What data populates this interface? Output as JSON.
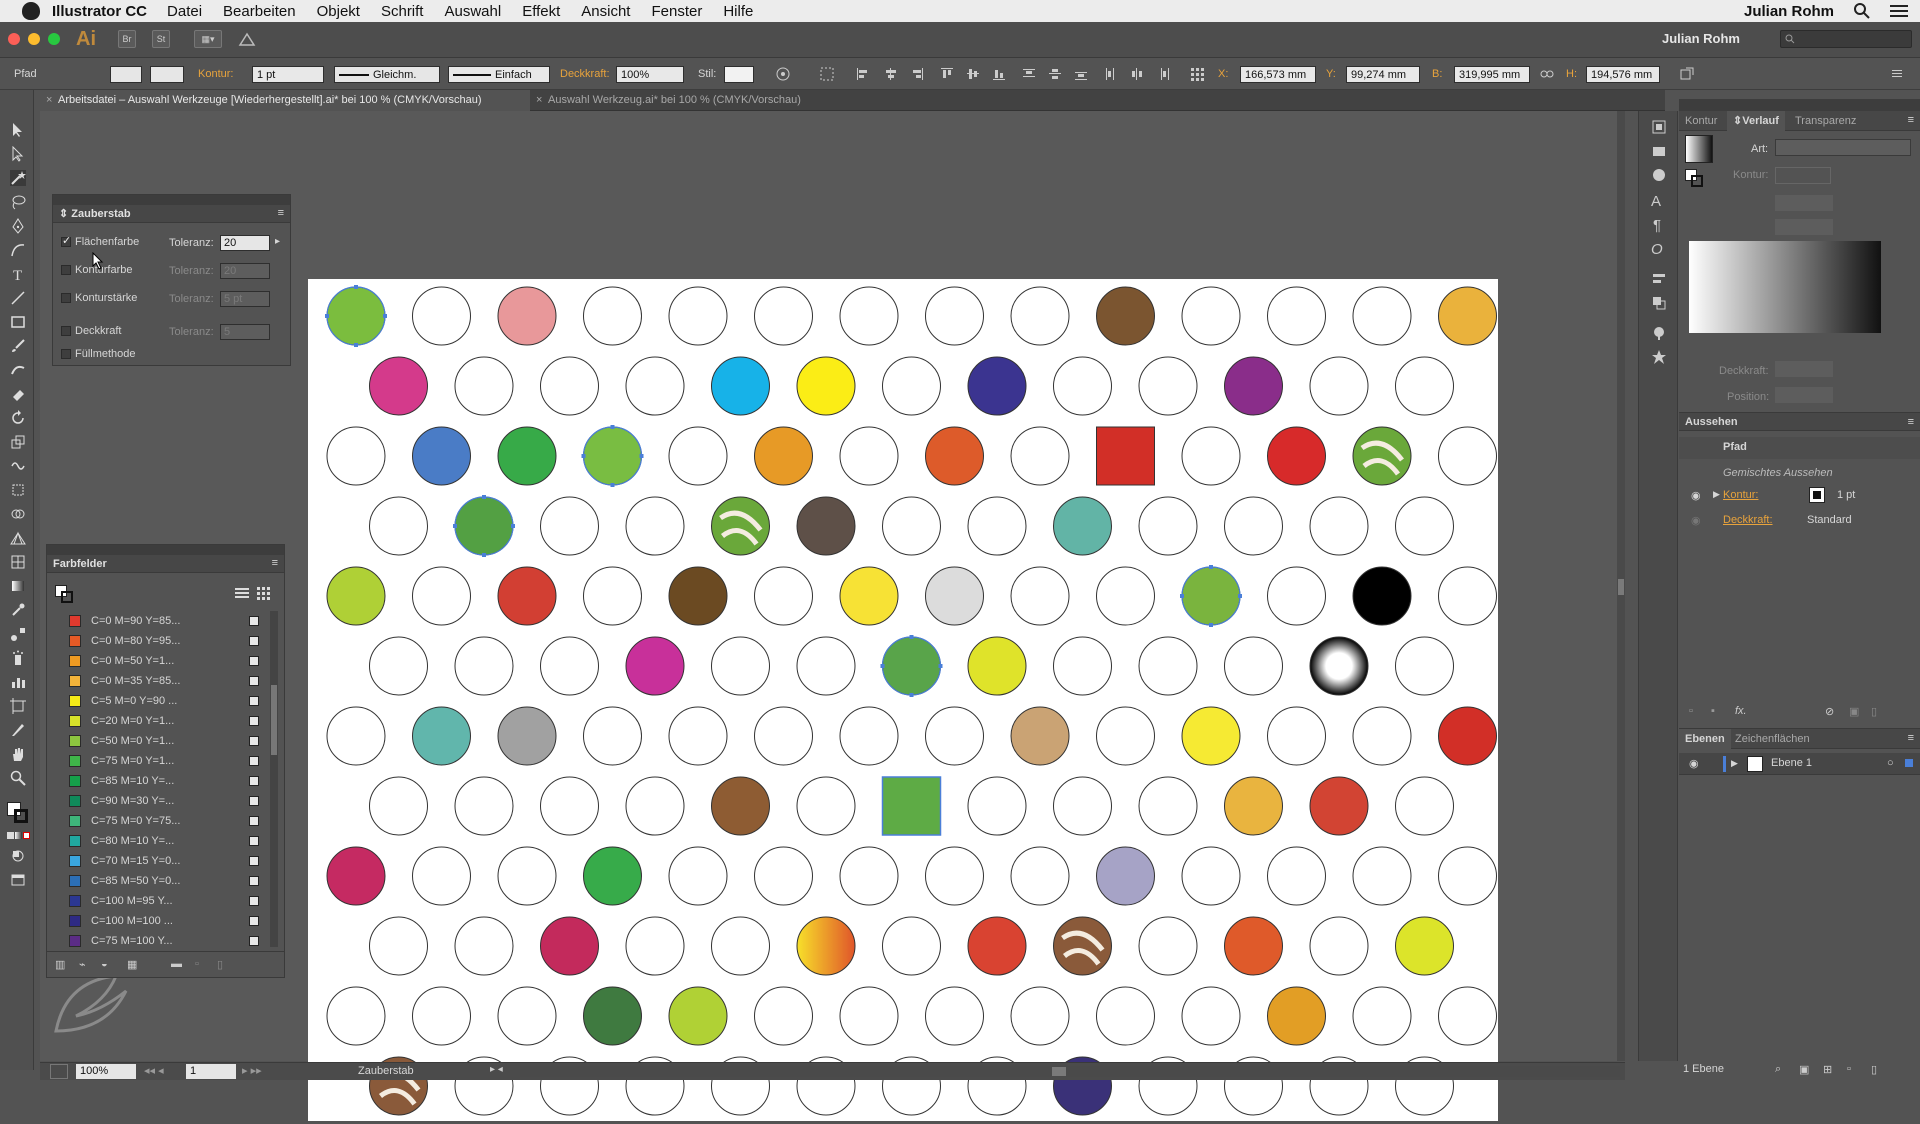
{
  "menubar": {
    "app_name": "Illustrator CC",
    "items": [
      "Datei",
      "Bearbeiten",
      "Objekt",
      "Schrift",
      "Auswahl",
      "Effekt",
      "Ansicht",
      "Fenster",
      "Hilfe"
    ],
    "user": "Julian Rohm"
  },
  "appbar": {
    "logo": "Ai",
    "bridge": "Br",
    "stock": "St",
    "workspace": "Julian Rohm"
  },
  "control": {
    "selection": "Pfad",
    "kontur_label": "Kontur:",
    "kontur_value": "1 pt",
    "stroke_profile": "Gleichm.",
    "brush": "Einfach",
    "deckkraft_label": "Deckkraft:",
    "deckkraft_value": "100%",
    "stil_label": "Stil:",
    "x_label": "X:",
    "x_value": "166,573 mm",
    "y_label": "Y:",
    "y_value": "99,274 mm",
    "b_label": "B:",
    "b_value": "319,995 mm",
    "h_label": "H:",
    "h_value": "194,576 mm"
  },
  "tabs": [
    {
      "label": "Arbeitsdatei – Auswahl Werkzeuge [Wiederhergestellt].ai* bei 100 % (CMYK/Vorschau)",
      "active": true
    },
    {
      "label": "Auswahl Werkzeug.ai* bei 100 % (CMYK/Vorschau)",
      "active": false
    }
  ],
  "zauberstab": {
    "title": "Zauberstab",
    "options": [
      {
        "label": "Flächenfarbe",
        "checked": true,
        "tol_label": "Toleranz:",
        "tol": "20",
        "enabled": true
      },
      {
        "label": "Konturfarbe",
        "checked": false,
        "tol_label": "Toleranz:",
        "tol": "20",
        "enabled": false
      },
      {
        "label": "Konturstärke",
        "checked": false,
        "tol_label": "Toleranz:",
        "tol": "5 pt",
        "enabled": false
      },
      {
        "label": "Deckkraft",
        "checked": false,
        "tol_label": "Toleranz:",
        "tol": "5",
        "enabled": false
      },
      {
        "label": "Füllmethode",
        "checked": false,
        "tol_label": "",
        "tol": "",
        "enabled": false
      }
    ]
  },
  "farbfelder": {
    "title": "Farbfelder",
    "swatches": [
      {
        "label": "C=0 M=90 Y=85...",
        "color": "#e03a2e"
      },
      {
        "label": "C=0 M=80 Y=95...",
        "color": "#e55a26"
      },
      {
        "label": "C=0 M=50 Y=1...",
        "color": "#ee9a22"
      },
      {
        "label": "C=0 M=35 Y=85...",
        "color": "#f4b43a"
      },
      {
        "label": "C=5 M=0 Y=90 ...",
        "color": "#f5ea17"
      },
      {
        "label": "C=20 M=0 Y=1...",
        "color": "#d7e22a"
      },
      {
        "label": "C=50 M=0 Y=1...",
        "color": "#8dc63f"
      },
      {
        "label": "C=75 M=0 Y=1...",
        "color": "#3fb549"
      },
      {
        "label": "C=85 M=10 Y=...",
        "color": "#15a04a"
      },
      {
        "label": "C=90 M=30 Y=...",
        "color": "#108a5a"
      },
      {
        "label": "C=75 M=0 Y=75...",
        "color": "#3eb57a"
      },
      {
        "label": "C=80 M=10 Y=...",
        "color": "#20a8a0"
      },
      {
        "label": "C=70 M=15 Y=0...",
        "color": "#3aa6df"
      },
      {
        "label": "C=85 M=50 Y=0...",
        "color": "#2c6fb6"
      },
      {
        "label": "C=100 M=95 Y...",
        "color": "#2b3792"
      },
      {
        "label": "C=100 M=100 ...",
        "color": "#2e2a84"
      },
      {
        "label": "C=75 M=100 Y...",
        "color": "#5b2c86"
      }
    ]
  },
  "right": {
    "tabs": [
      "Kontur",
      "Verlauf",
      "Transparenz"
    ],
    "art_label": "Art:",
    "kontur_label": "Kontur:",
    "deckkraft_label": "Deckkraft:",
    "position_label": "Position:",
    "aussehen_title": "Aussehen",
    "aussehen_obj": "Pfad",
    "aussehen_mixed": "Gemischtes Aussehen",
    "aussehen_kontur": "Kontur:",
    "aussehen_kontur_val": "1 pt",
    "aussehen_deck": "Deckkraft:",
    "aussehen_deck_val": "Standard",
    "ebenen_tabs": [
      "Ebenen",
      "Zeichenflächen"
    ],
    "layer_name": "Ebene 1",
    "layer_count": "1 Ebene"
  },
  "status": {
    "zoom": "100%",
    "page": "1",
    "tool": "Zauberstab"
  },
  "artboard": {
    "rows": [
      [
        "#7bbd3e",
        "",
        "#e8989a",
        "",
        "",
        "",
        "",
        "",
        "",
        "#7b5530",
        "",
        "",
        "",
        "#eab23c"
      ],
      [
        "#d43a8b",
        "",
        "",
        "",
        "#17b2e8",
        "#fbed16",
        "",
        "#3b3490",
        "",
        "",
        "#8a2d8a",
        "",
        ""
      ],
      [
        "",
        "#4a7cc6",
        "#37aa48",
        "#79bd42",
        "",
        "#e79a26",
        "",
        "#dd5b2a",
        "",
        "#d22f27",
        "",
        "#d72a2a",
        "leaf",
        ""
      ],
      [
        "",
        "#53a043",
        "",
        "",
        "leaf",
        "#5e5048",
        "",
        "",
        "#62b4a6",
        "",
        "",
        "",
        ""
      ],
      [
        "#afd036",
        "",
        "#d23f33",
        "",
        "#6b4a22",
        "",
        "#f7e235",
        "#dcdcdc",
        "",
        "",
        "#7ab43e",
        "",
        "#000000",
        ""
      ],
      [
        "",
        "",
        "",
        "#c8309a",
        "",
        "",
        "#59a44a",
        "#dfe32a",
        "",
        "",
        "",
        "ring",
        ""
      ],
      [
        "",
        "#61b6ac",
        "#a1a1a1",
        "",
        "",
        "",
        "",
        "",
        "#caa374",
        "",
        "#f6ea33",
        "",
        "",
        "#d22f27"
      ],
      [
        "",
        "",
        "",
        "",
        "#8e5c33",
        "",
        "#5eab45",
        "",
        "",
        "",
        "#e9b43f",
        "#d24433",
        ""
      ],
      [
        "#c52a62",
        "",
        "",
        "#37ab4a",
        "",
        "",
        "",
        "",
        "",
        "#a6a3c6",
        "",
        "",
        "",
        "",
        ""
      ],
      [
        "",
        "",
        "#c32a5c",
        "",
        "",
        "grad",
        "",
        "#d94331",
        "wood",
        "",
        "#df5a2a",
        "",
        "#dce42a"
      ],
      [
        "",
        "",
        "",
        "#3f7a40",
        "#b0d135",
        "",
        "",
        "",
        "",
        "",
        "",
        "#e29e25",
        "",
        ""
      ],
      [
        "wood",
        "",
        "",
        "",
        "",
        "",
        "",
        "",
        "#3a3178",
        "",
        "",
        "",
        ""
      ]
    ]
  }
}
